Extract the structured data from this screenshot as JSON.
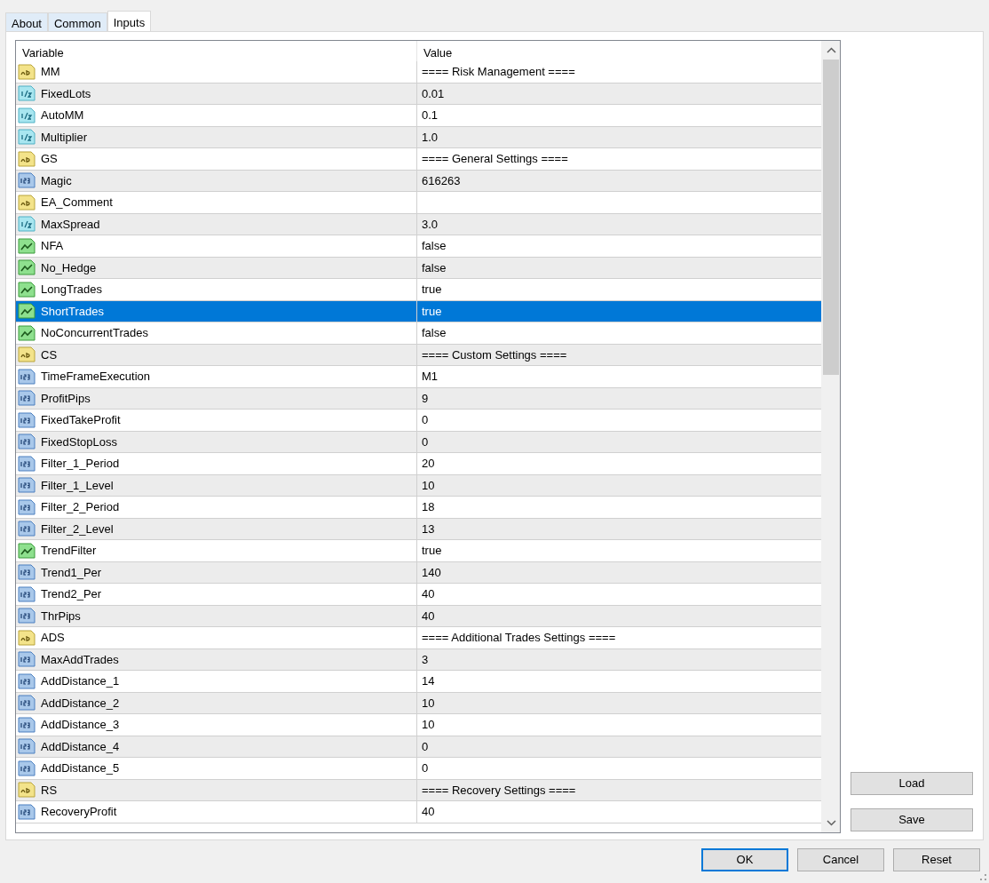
{
  "tabs": [
    {
      "label": "About",
      "selected": false
    },
    {
      "label": "Common",
      "selected": false
    },
    {
      "label": "Inputs",
      "selected": true
    }
  ],
  "table": {
    "columns": [
      "Variable",
      "Value"
    ],
    "rows": [
      {
        "kind": "string",
        "name": "MM",
        "value": "==== Risk Management ====",
        "selected": false
      },
      {
        "kind": "double",
        "name": "FixedLots",
        "value": "0.01",
        "selected": false
      },
      {
        "kind": "double",
        "name": "AutoMM",
        "value": "0.1",
        "selected": false
      },
      {
        "kind": "double",
        "name": "Multiplier",
        "value": "1.0",
        "selected": false
      },
      {
        "kind": "string",
        "name": "GS",
        "value": "==== General Settings ====",
        "selected": false
      },
      {
        "kind": "int",
        "name": "Magic",
        "value": "616263",
        "selected": false
      },
      {
        "kind": "string",
        "name": "EA_Comment",
        "value": "",
        "selected": false
      },
      {
        "kind": "double",
        "name": "MaxSpread",
        "value": "3.0",
        "selected": false
      },
      {
        "kind": "bool",
        "name": "NFA",
        "value": "false",
        "selected": false
      },
      {
        "kind": "bool",
        "name": "No_Hedge",
        "value": "false",
        "selected": false
      },
      {
        "kind": "bool",
        "name": "LongTrades",
        "value": "true",
        "selected": false
      },
      {
        "kind": "bool",
        "name": "ShortTrades",
        "value": "true",
        "selected": true
      },
      {
        "kind": "bool",
        "name": "NoConcurrentTrades",
        "value": "false",
        "selected": false
      },
      {
        "kind": "string",
        "name": "CS",
        "value": "==== Custom Settings ====",
        "selected": false
      },
      {
        "kind": "int",
        "name": "TimeFrameExecution",
        "value": "M1",
        "selected": false
      },
      {
        "kind": "int",
        "name": "ProfitPips",
        "value": "9",
        "selected": false
      },
      {
        "kind": "int",
        "name": "FixedTakeProfit",
        "value": "0",
        "selected": false
      },
      {
        "kind": "int",
        "name": "FixedStopLoss",
        "value": "0",
        "selected": false
      },
      {
        "kind": "int",
        "name": "Filter_1_Period",
        "value": "20",
        "selected": false
      },
      {
        "kind": "int",
        "name": "Filter_1_Level",
        "value": "10",
        "selected": false
      },
      {
        "kind": "int",
        "name": "Filter_2_Period",
        "value": "18",
        "selected": false
      },
      {
        "kind": "int",
        "name": "Filter_2_Level",
        "value": "13",
        "selected": false
      },
      {
        "kind": "bool",
        "name": "TrendFilter",
        "value": "true",
        "selected": false
      },
      {
        "kind": "int",
        "name": "Trend1_Per",
        "value": "140",
        "selected": false
      },
      {
        "kind": "int",
        "name": "Trend2_Per",
        "value": "40",
        "selected": false
      },
      {
        "kind": "int",
        "name": "ThrPips",
        "value": "40",
        "selected": false
      },
      {
        "kind": "string",
        "name": "ADS",
        "value": "==== Additional Trades Settings ====",
        "selected": false
      },
      {
        "kind": "int",
        "name": "MaxAddTrades",
        "value": "3",
        "selected": false
      },
      {
        "kind": "int",
        "name": "AddDistance_1",
        "value": "14",
        "selected": false
      },
      {
        "kind": "int",
        "name": "AddDistance_2",
        "value": "10",
        "selected": false
      },
      {
        "kind": "int",
        "name": "AddDistance_3",
        "value": "10",
        "selected": false
      },
      {
        "kind": "int",
        "name": "AddDistance_4",
        "value": "0",
        "selected": false
      },
      {
        "kind": "int",
        "name": "AddDistance_5",
        "value": "0",
        "selected": false
      },
      {
        "kind": "string",
        "name": "RS",
        "value": "==== Recovery Settings ====",
        "selected": false
      },
      {
        "kind": "int",
        "name": "RecoveryProfit",
        "value": "40",
        "selected": false
      }
    ]
  },
  "side_buttons": [
    "Load",
    "Save"
  ],
  "buttons": [
    {
      "label": "OK",
      "default": true
    },
    {
      "label": "Cancel",
      "default": false
    },
    {
      "label": "Reset",
      "default": false
    }
  ]
}
